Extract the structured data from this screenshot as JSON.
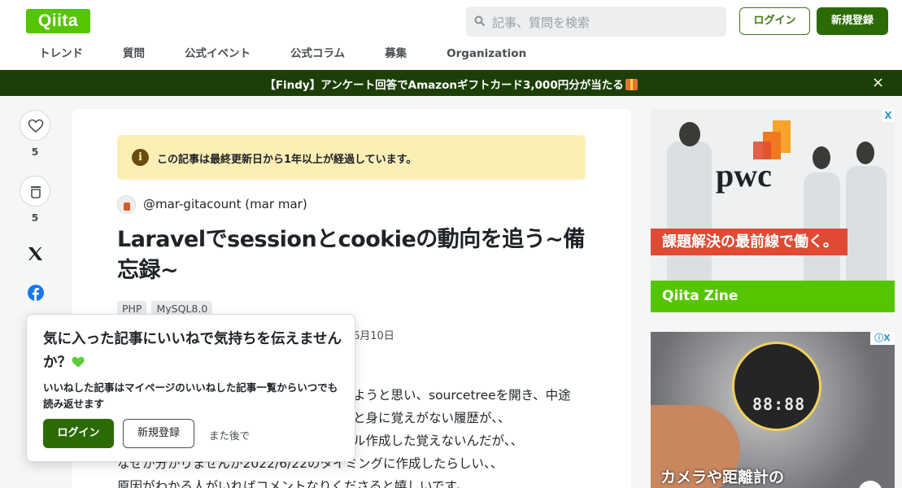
{
  "header": {
    "logo": "Qiita",
    "search_placeholder": "記事、質問を検索",
    "login": "ログイン",
    "signup": "新規登録",
    "nav": [
      "トレンド",
      "質問",
      "公式イベント",
      "公式コラム",
      "募集",
      "Organization"
    ]
  },
  "banner": {
    "text": "【Findy】アンケート回答でAmazonギフトカード3,000円分が当たる",
    "close": "×"
  },
  "actions": {
    "like_count": "5",
    "stock_count": "5"
  },
  "article": {
    "notice": "この記事は最終更新日から1年以上が経過しています。",
    "author": "@mar-gitacount (mar mar)",
    "title": "Laravelでsessionとcookieの動向を追う~備忘録~",
    "tags": [
      "PHP",
      "MySQL8.0"
    ],
    "date_partial": "6月10日",
    "body_lines": [
      "ようと思い、sourcetreeを開き、中途",
      "と身に覚えがない履歴が、、",
      "ル作成した覚えないんだが、、",
      "なぜか分かりませんが2022/6/22のタイミングに作成したらしい、、",
      "原因がわかる人がいればコメントなりくださると嬉しいです。"
    ]
  },
  "ads": {
    "ad1_brand": "pwc",
    "ad1_tagline": "課題解決の最前線で働く。",
    "ad1_footer": "Qiita Zine",
    "ad1_corner": "X",
    "ad2_caption": "カメラや距離計の",
    "ad2_display": "88:88",
    "ad2_corner": "ⓘX"
  },
  "popup": {
    "title": "気に入った記事にいいねで気持ちを伝えませんか？",
    "description": "いいねした記事はマイページのいいねした記事一覧からいつでも読み返せます",
    "login": "ログイン",
    "signup": "新規登録",
    "later": "また後で"
  }
}
